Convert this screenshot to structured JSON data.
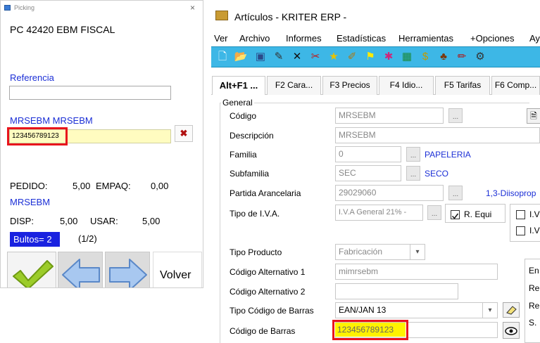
{
  "picking": {
    "window_title": "Picking",
    "close_glyph": "×",
    "header": "PC 42420  EBM FISCAL",
    "referencia_label": "Referencia",
    "referencia_value": "",
    "article_code": "MRSEBM  MRSEBM",
    "barcode_value": "123456789123",
    "clear_glyph": "✖",
    "pedido_label": "PEDIDO:",
    "pedido_value": "5,00",
    "empaq_label": "EMPAQ:",
    "empaq_value": "0,00",
    "article_code_2": "MRSEBM",
    "disp_label": "DISP:",
    "disp_value": "5,00",
    "usar_label": "USAR:",
    "usar_value": "5,00",
    "bultos_label": "Bultos= 2",
    "page_indicator": "(1/2)",
    "back_button": "Volver",
    "icons": [
      "check-icon",
      "arrow-left-icon",
      "arrow-right-icon"
    ],
    "colors": {
      "link_blue": "#1b2fd6",
      "bultos_bg": "#1a22e0",
      "highlight_red": "#e8141c",
      "barcode_bg": "#fffcc0"
    }
  },
  "articulos": {
    "window_title": "Artículos - KRITER ERP -",
    "menu": [
      "Ver",
      "Archivo",
      "Informes",
      "Estadísticas",
      "Herramientas",
      "+Opciones",
      "Ay"
    ],
    "toolbar_color": "#3db7e6",
    "tabs": [
      "Alt+F1 ...",
      "F2 Cara...",
      "F3 Precios",
      "F4 Idio...",
      "F5 Tarifas",
      "F6 Comp..."
    ],
    "group_label": "General",
    "fields": {
      "codigo_label": "Código",
      "codigo_value": "MRSEBM",
      "descripcion_label": "Descripción",
      "descripcion_value": "MRSEBM",
      "familia_label": "Familia",
      "familia_value": "0",
      "familia_name": "PAPELERIA",
      "subfamilia_label": "Subfamilia",
      "subfamilia_value": "SEC",
      "subfamilia_name": "SECO",
      "partida_label": "Partida Arancelaria",
      "partida_value": "29029060",
      "partida_desc": "1,3-Diisoprop",
      "iva_label": "Tipo de I.V.A.",
      "iva_value": "I.V.A General 21% -",
      "r_equi_label": "R. Equi",
      "iva_side_1": "I.V",
      "iva_side_2": "I.V",
      "tipo_producto_label": "Tipo Producto",
      "tipo_producto_value": "Fabricación",
      "alt1_label": "Código Alternativo 1",
      "alt1_value": "mimrsebm",
      "alt2_label": "Código Alternativo 2",
      "alt2_value": "",
      "tipo_barras_label": "Tipo Código de Barras",
      "tipo_barras_value": "EAN/JAN 13",
      "barras_label": "Código de Barras",
      "barras_value": "123456789123",
      "side_letters": [
        "En",
        "Re",
        "Re",
        "S."
      ]
    },
    "dots_glyph": "..."
  }
}
